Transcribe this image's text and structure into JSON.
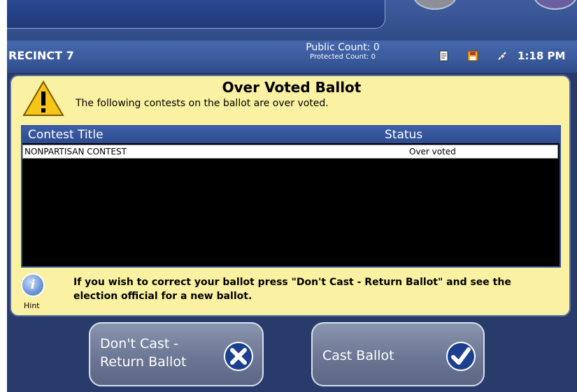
{
  "status_bar": {
    "precinct": "RECINCT 7",
    "public_count": "Public Count: 0",
    "protected_count": "Protected Count: 0",
    "time": "1:18 PM"
  },
  "dialog": {
    "title": "Over Voted Ballot",
    "subtitle": "The following contests on the ballot are over voted.",
    "table": {
      "headers": [
        "Contest Title",
        "Status"
      ],
      "rows": [
        {
          "contest": "NONPARTISAN CONTEST",
          "status": "Over voted"
        }
      ]
    },
    "hint": {
      "label": "Hint",
      "text": "If you wish to correct your ballot press \"Don't Cast - Return Ballot\" and see the election official for a new ballot."
    }
  },
  "buttons": {
    "dont_cast": "Don't Cast - Return Ballot",
    "cast": "Cast Ballot"
  },
  "colors": {
    "dialog_background": "#fbf1a2",
    "header_blue": "#3a5a9b",
    "warning_yellow": "#f5c518"
  }
}
